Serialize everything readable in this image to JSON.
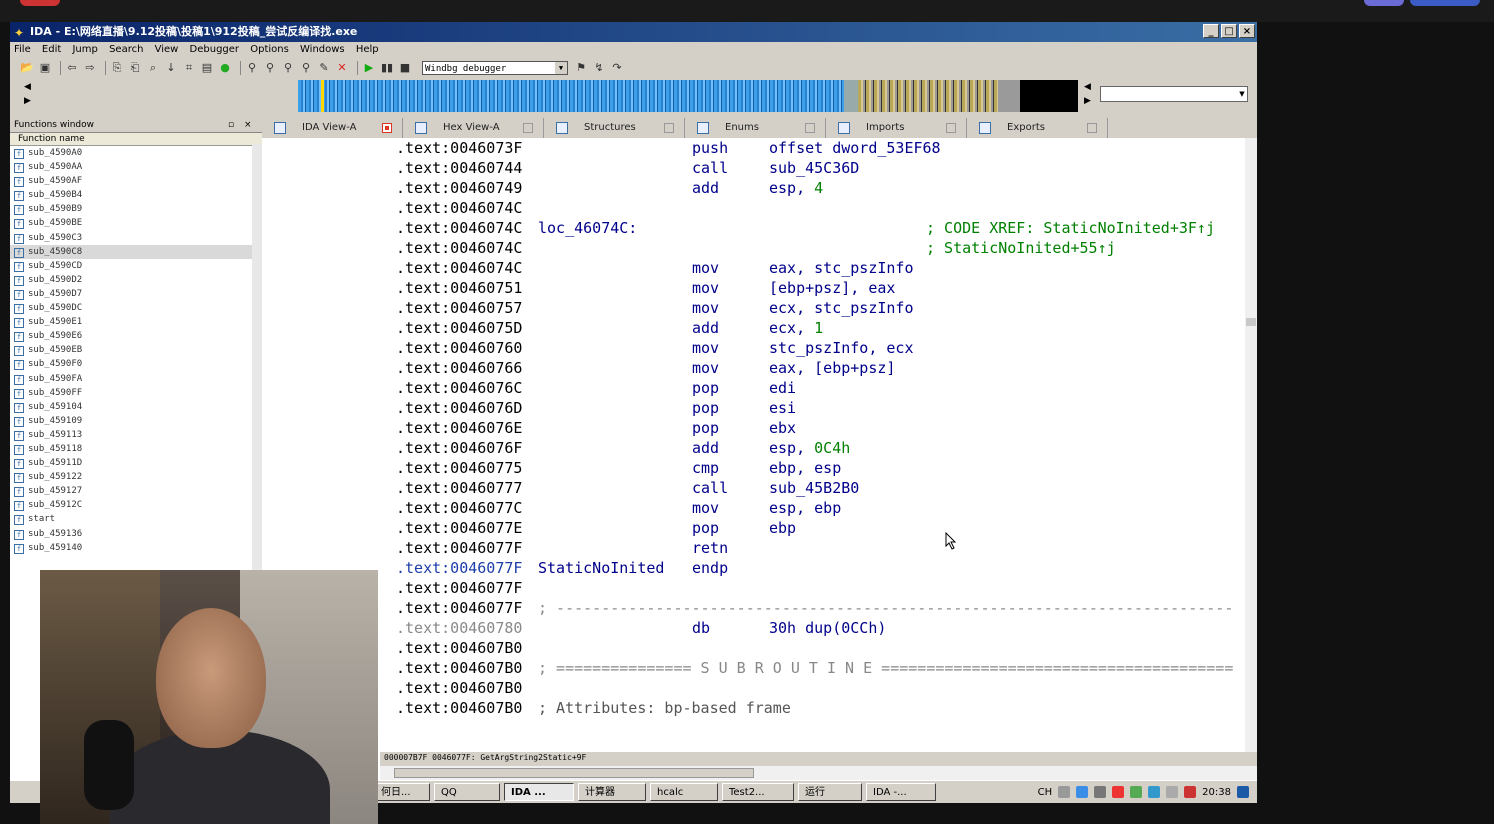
{
  "window": {
    "title": "IDA - E:\\网络直播\\9.12投稿\\投稿1\\912投稿_尝试反编译找.exe"
  },
  "menu": [
    "File",
    "Edit",
    "Jump",
    "Search",
    "View",
    "Debugger",
    "Options",
    "Windows",
    "Help"
  ],
  "toolbar": {
    "debugger_select": "Windbg debugger"
  },
  "functions_window": {
    "title": "Functions window",
    "column_header": "Function name",
    "items": [
      "sub_4590A0",
      "sub_4590AA",
      "sub_4590AF",
      "sub_4590B4",
      "sub_4590B9",
      "sub_4590BE",
      "sub_4590C3",
      "sub_4590C8",
      "sub_4590CD",
      "sub_4590D2",
      "sub_4590D7",
      "sub_4590DC",
      "sub_4590E1",
      "sub_4590E6",
      "sub_4590EB",
      "sub_4590F0",
      "sub_4590FA",
      "sub_4590FF",
      "sub_459104",
      "sub_459109",
      "sub_459113",
      "sub_459118",
      "sub_45911D",
      "sub_459122",
      "sub_459127",
      "sub_45912C",
      "start",
      "sub_459136",
      "sub_459140"
    ],
    "selected_index": 7
  },
  "tabs": [
    {
      "label": "IDA View-A",
      "active": true
    },
    {
      "label": "Hex View-A",
      "active": false
    },
    {
      "label": "Structures",
      "active": false
    },
    {
      "label": "Enums",
      "active": false
    },
    {
      "label": "Imports",
      "active": false
    },
    {
      "label": "Exports",
      "active": false
    }
  ],
  "code_lines": [
    {
      "addr": ".text:0046073F",
      "label": "",
      "mnem": "push",
      "ops": "offset dword_53EF68"
    },
    {
      "addr": ".text:00460744",
      "label": "",
      "mnem": "call",
      "ops": "sub_45C36D"
    },
    {
      "addr": ".text:00460749",
      "label": "",
      "mnem": "add",
      "ops": "esp, 4"
    },
    {
      "addr": ".text:0046074C",
      "label": "",
      "mnem": "",
      "ops": ""
    },
    {
      "addr": ".text:0046074C",
      "label": "loc_46074C:",
      "mnem": "",
      "ops": "",
      "comment": "; CODE XREF: StaticNoInited+3F↑j"
    },
    {
      "addr": ".text:0046074C",
      "label": "",
      "mnem": "",
      "ops": "",
      "comment": "; StaticNoInited+55↑j"
    },
    {
      "addr": ".text:0046074C",
      "label": "",
      "mnem": "mov",
      "ops": "eax, stc_pszInfo"
    },
    {
      "addr": ".text:00460751",
      "label": "",
      "mnem": "mov",
      "ops": "[ebp+psz], eax"
    },
    {
      "addr": ".text:00460757",
      "label": "",
      "mnem": "mov",
      "ops": "ecx, stc_pszInfo"
    },
    {
      "addr": ".text:0046075D",
      "label": "",
      "mnem": "add",
      "ops": "ecx, 1"
    },
    {
      "addr": ".text:00460760",
      "label": "",
      "mnem": "mov",
      "ops": "stc_pszInfo, ecx"
    },
    {
      "addr": ".text:00460766",
      "label": "",
      "mnem": "mov",
      "ops": "eax, [ebp+psz]"
    },
    {
      "addr": ".text:0046076C",
      "label": "",
      "mnem": "pop",
      "ops": "edi"
    },
    {
      "addr": ".text:0046076D",
      "label": "",
      "mnem": "pop",
      "ops": "esi"
    },
    {
      "addr": ".text:0046076E",
      "label": "",
      "mnem": "pop",
      "ops": "ebx"
    },
    {
      "addr": ".text:0046076F",
      "label": "",
      "mnem": "add",
      "ops": "esp, 0C4h"
    },
    {
      "addr": ".text:00460775",
      "label": "",
      "mnem": "cmp",
      "ops": "ebp, esp"
    },
    {
      "addr": ".text:00460777",
      "label": "",
      "mnem": "call",
      "ops": "sub_45B2B0"
    },
    {
      "addr": ".text:0046077C",
      "label": "",
      "mnem": "mov",
      "ops": "esp, ebp"
    },
    {
      "addr": ".text:0046077E",
      "label": "",
      "mnem": "pop",
      "ops": "ebp"
    },
    {
      "addr": ".text:0046077F",
      "label": "",
      "mnem": "retn",
      "ops": ""
    },
    {
      "addr": ".text:0046077F",
      "label": "StaticNoInited",
      "mnem": "endp",
      "ops": ""
    },
    {
      "addr": ".text:0046077F",
      "label": "",
      "mnem": "",
      "ops": ""
    },
    {
      "addr": ".text:0046077F",
      "label": "",
      "mnem": "",
      "ops": "",
      "raw": "; ---------------------------------------------------------------------------"
    },
    {
      "addr": ".text:00460780",
      "label": "",
      "mnem": "db",
      "ops": "30h dup(0CCh)"
    },
    {
      "addr": ".text:004607B0",
      "label": "",
      "mnem": "",
      "ops": ""
    },
    {
      "addr": ".text:004607B0",
      "label": "",
      "mnem": "",
      "ops": "",
      "raw": "; =============== S U B R O U T I N E ======================================="
    },
    {
      "addr": ".text:004607B0",
      "label": "",
      "mnem": "",
      "ops": ""
    },
    {
      "addr": ".text:004607B0",
      "label": "",
      "mnem": "",
      "ops": "",
      "raw": "; Attributes: bp-based frame"
    }
  ],
  "status_line": "000007B7F 0046077F: GetArgString2Static+9F",
  "taskbar": {
    "items": [
      "何日...",
      "QQ",
      "IDA ...",
      "计算器",
      "hcalc",
      "Test2...",
      "运行",
      "IDA -..."
    ],
    "active_index": 2,
    "lang": "CH",
    "clock": "20:38"
  },
  "colors": {
    "title_start": "#0a246a",
    "title_end": "#3a6ea5",
    "mnemonic": "#00008b",
    "comment": "#008000",
    "number": "#008000"
  }
}
